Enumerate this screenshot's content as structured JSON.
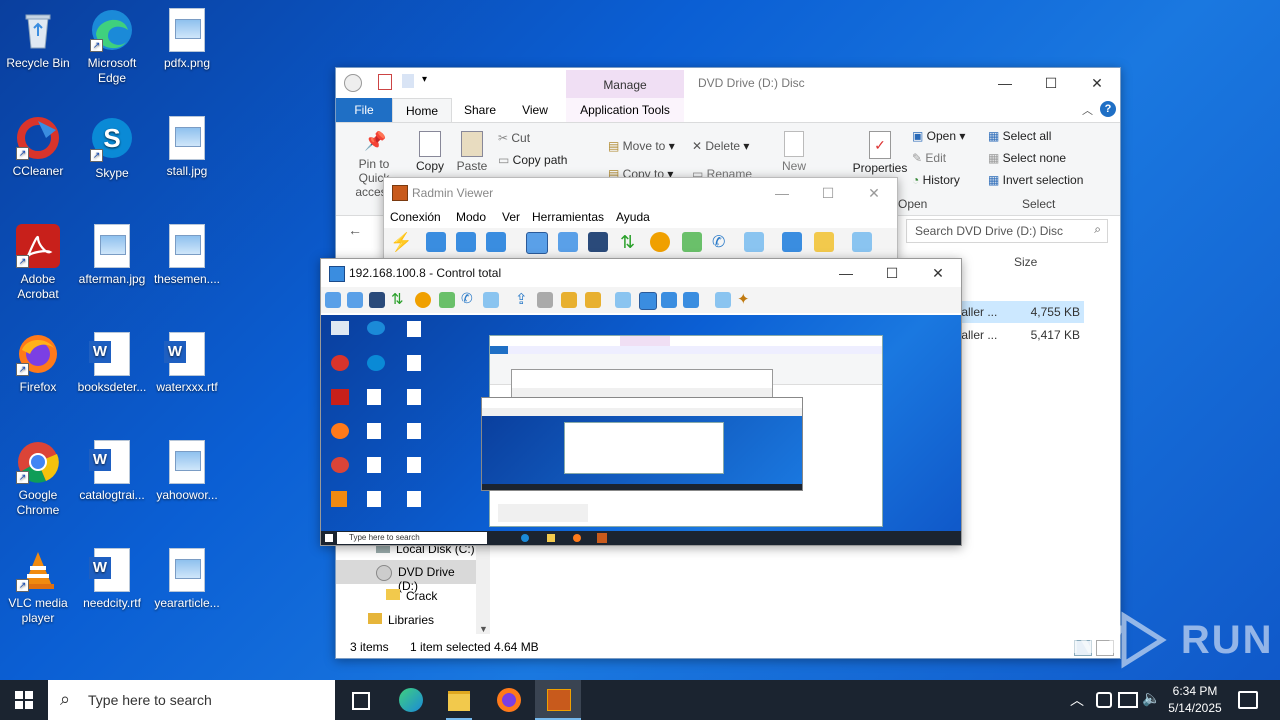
{
  "desktop": {
    "icons": [
      {
        "label": "Recycle Bin"
      },
      {
        "label": "Microsoft Edge"
      },
      {
        "label": "pdfx.png"
      },
      {
        "label": "CCleaner"
      },
      {
        "label": "Skype"
      },
      {
        "label": "stall.jpg"
      },
      {
        "label": "Adobe Acrobat"
      },
      {
        "label": "afterman.jpg"
      },
      {
        "label": "thesemen...."
      },
      {
        "label": "Firefox"
      },
      {
        "label": "booksdeter..."
      },
      {
        "label": "waterxxx.rtf"
      },
      {
        "label": "Google Chrome"
      },
      {
        "label": "catalogtrai..."
      },
      {
        "label": "yahoowor..."
      },
      {
        "label": "VLC media player"
      },
      {
        "label": "needcity.rtf"
      },
      {
        "label": "yeararticle..."
      }
    ]
  },
  "explorer": {
    "title": "DVD Drive (D:) Disc",
    "manage_tab": "Manage",
    "tabs": [
      "File",
      "Home",
      "Share",
      "View",
      "Application Tools"
    ],
    "ribbon": {
      "pin": "Pin to Quick access",
      "copy": "Copy",
      "paste": "Paste",
      "cut": "Cut",
      "copy_path": "Copy path",
      "move_to": "Move to",
      "copy_to": "Copy to",
      "delete": "Delete",
      "rename": "Rename",
      "new": "New",
      "properties": "Properties",
      "open": "Open",
      "edit": "Edit",
      "history": "History",
      "open_group": "Open",
      "select_all": "Select all",
      "select_none": "Select none",
      "invert_selection": "Invert selection",
      "select_group": "Select"
    },
    "search_placeholder": "Search DVD Drive (D:) Disc",
    "column_size": "Size",
    "files": [
      {
        "name": "taller ...",
        "size": "4,755 KB"
      },
      {
        "name": "taller ...",
        "size": "5,417 KB"
      }
    ],
    "nav": [
      {
        "label": "Local Disk (C:)"
      },
      {
        "label": "DVD Drive (D:)"
      },
      {
        "label": "Crack"
      },
      {
        "label": "Libraries"
      }
    ],
    "status": {
      "items": "3 items",
      "selected": "1 item selected",
      "size": "4.64 MB"
    }
  },
  "radmin": {
    "title": "Radmin Viewer",
    "menu": [
      "Conexión",
      "Modo",
      "Ver",
      "Herramientas",
      "Ayuda"
    ]
  },
  "control": {
    "title": "192.168.100.8 - Control total",
    "remote_search": "Type here to search"
  },
  "taskbar": {
    "search_placeholder": "Type here to search",
    "time": "6:34 PM",
    "date": "5/14/2025"
  },
  "watermark": "ANY RUN"
}
